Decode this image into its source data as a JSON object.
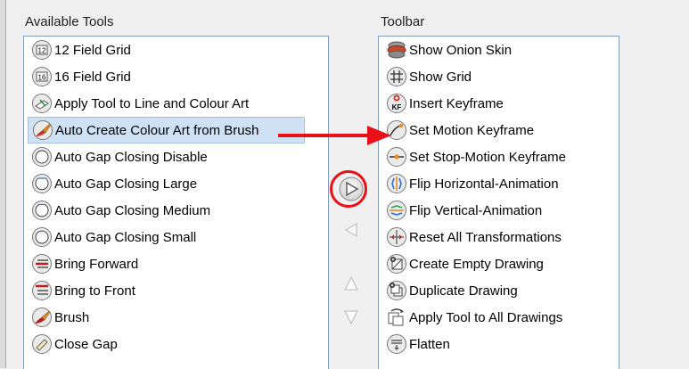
{
  "available": {
    "header": "Available Tools",
    "items": [
      {
        "label": "12 Field Grid",
        "icon": "field-grid-12-icon"
      },
      {
        "label": "16 Field Grid",
        "icon": "field-grid-16-icon"
      },
      {
        "label": "Apply Tool to Line and Colour Art",
        "icon": "apply-line-colour-icon"
      },
      {
        "label": "Auto Create Colour Art from Brush",
        "icon": "brush-create-colour-icon",
        "selected": true
      },
      {
        "label": "Auto Gap Closing Disable",
        "icon": "gap-closing-disable-icon"
      },
      {
        "label": "Auto Gap Closing Large",
        "icon": "gap-closing-large-icon"
      },
      {
        "label": "Auto Gap Closing Medium",
        "icon": "gap-closing-medium-icon"
      },
      {
        "label": "Auto Gap Closing Small",
        "icon": "gap-closing-small-icon"
      },
      {
        "label": "Bring Forward",
        "icon": "bring-forward-icon"
      },
      {
        "label": "Bring to Front",
        "icon": "bring-to-front-icon"
      },
      {
        "label": "Brush",
        "icon": "brush-icon"
      },
      {
        "label": "Close Gap",
        "icon": "close-gap-icon"
      }
    ]
  },
  "toolbar": {
    "header": "Toolbar",
    "items": [
      {
        "label": "Show Onion Skin",
        "icon": "onion-skin-icon"
      },
      {
        "label": "Show Grid",
        "icon": "grid-icon"
      },
      {
        "label": "Insert Keyframe",
        "icon": "insert-keyframe-icon"
      },
      {
        "label": "Set Motion Keyframe",
        "icon": "motion-keyframe-icon"
      },
      {
        "label": "Set Stop-Motion Keyframe",
        "icon": "stop-motion-keyframe-icon"
      },
      {
        "label": "Flip Horizontal-Animation",
        "icon": "flip-horizontal-icon"
      },
      {
        "label": "Flip Vertical-Animation",
        "icon": "flip-vertical-icon"
      },
      {
        "label": "Reset All Transformations",
        "icon": "reset-transformations-icon"
      },
      {
        "label": "Create Empty Drawing",
        "icon": "create-empty-drawing-icon"
      },
      {
        "label": "Duplicate Drawing",
        "icon": "duplicate-drawing-icon"
      },
      {
        "label": "Apply Tool to All Drawings",
        "icon": "apply-all-drawings-icon"
      },
      {
        "label": "Flatten",
        "icon": "flatten-icon"
      }
    ]
  },
  "buttons": {
    "add": "add-to-toolbar-button",
    "remove": "remove-from-toolbar-button",
    "up": "move-up-button",
    "down": "move-down-button"
  },
  "colors": {
    "highlight": "#e8111a",
    "selection": "#cfe2f5"
  }
}
